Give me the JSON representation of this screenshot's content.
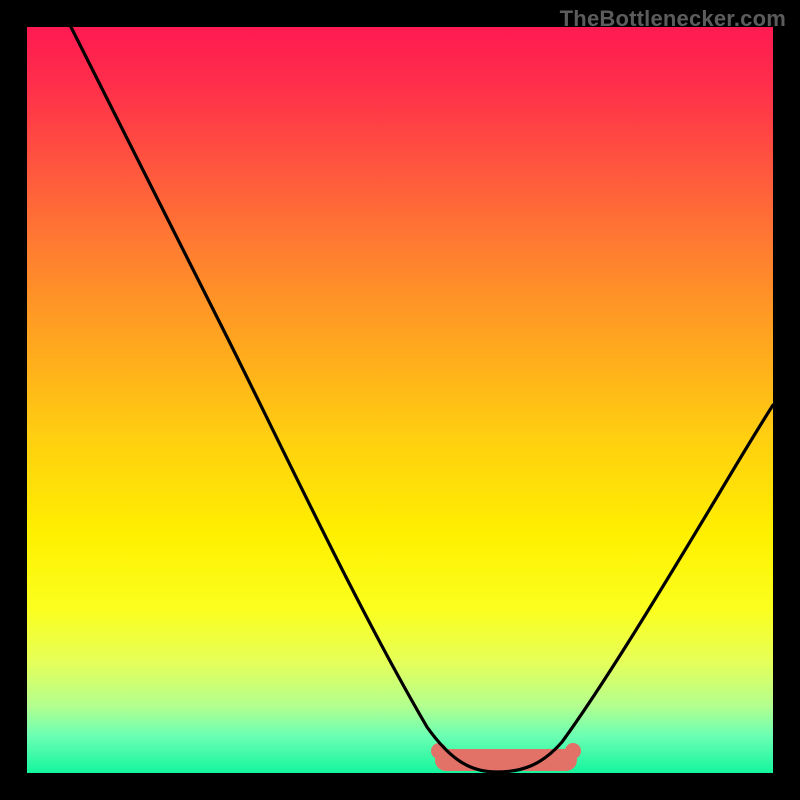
{
  "watermark": "TheBottlenecker.com",
  "colors": {
    "frame": "#000000",
    "curve": "#000000",
    "blob": "#e27168",
    "gradient_top": "#ff1a52",
    "gradient_bottom": "#14f59e"
  },
  "chart_data": {
    "type": "line",
    "title": "",
    "xlabel": "",
    "ylabel": "",
    "xlim": [
      0,
      100
    ],
    "ylim": [
      0,
      100
    ],
    "x": [
      0,
      5,
      10,
      15,
      20,
      25,
      30,
      35,
      40,
      45,
      50,
      55,
      57,
      60,
      63,
      67,
      70,
      73,
      77,
      80,
      85,
      90,
      95,
      100
    ],
    "values": [
      100,
      92,
      83,
      74,
      66,
      57,
      48,
      39,
      31,
      22,
      13,
      5,
      3,
      1,
      0,
      0,
      2,
      5,
      11,
      17,
      27,
      37,
      47,
      58
    ],
    "optimal_band_x": [
      57,
      73
    ],
    "annotations": []
  }
}
